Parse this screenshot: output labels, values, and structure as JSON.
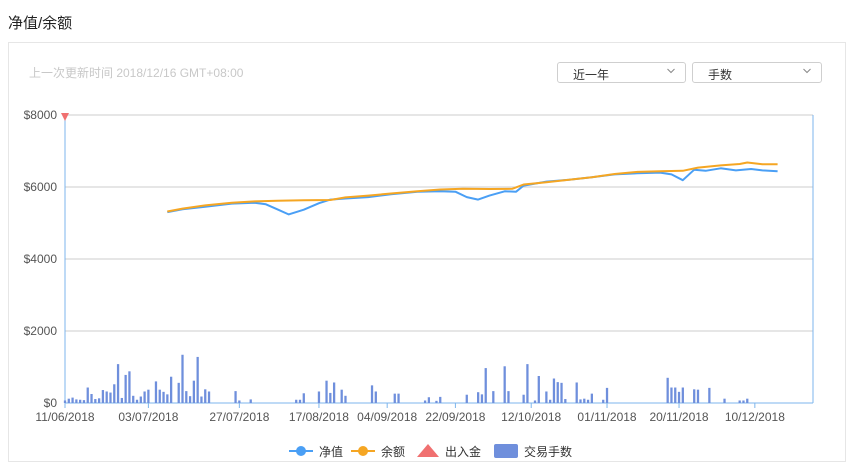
{
  "header": {
    "title": "净值/余额"
  },
  "last_update": "上一次更新时间 2018/12/16 GMT+08:00",
  "controls": {
    "period": {
      "selected": "近一年",
      "icon": "chevron-down-icon"
    },
    "metric": {
      "selected": "手数",
      "icon": "chevron-down-icon"
    }
  },
  "colors": {
    "net_value": "#4a9ff5",
    "balance": "#f5a623",
    "deposit_marker": "#f07070",
    "volume": "#6f8fdc",
    "grid": "#cccccc",
    "axis": "#7cb5ec"
  },
  "chart_data": {
    "type": "line",
    "x_tick_labels": [
      "11/06/2018",
      "03/07/2018",
      "27/07/2018",
      "17/08/2018",
      "04/09/2018",
      "22/09/2018",
      "12/10/2018",
      "01/11/2018",
      "20/11/2018",
      "10/12/2018"
    ],
    "x_ticks": [
      "2018-06-11",
      "2018-07-03",
      "2018-07-27",
      "2018-08-17",
      "2018-09-04",
      "2018-09-22",
      "2018-10-12",
      "2018-11-01",
      "2018-11-20",
      "2018-12-10"
    ],
    "y_tick_labels": [
      "$0",
      "$2000",
      "$4000",
      "$6000",
      "$8000"
    ],
    "y_ticks": [
      0,
      2000,
      4000,
      6000,
      8000
    ],
    "ylim": [
      0,
      8000
    ],
    "grid": true,
    "legend": {
      "placement": "bottom-center",
      "items": [
        {
          "label": "净值",
          "kind": "line",
          "series": "net_value"
        },
        {
          "label": "余额",
          "kind": "line",
          "series": "balance"
        },
        {
          "label": "出入金",
          "kind": "triangle",
          "series": "deposits"
        },
        {
          "label": "交易手数",
          "kind": "bar",
          "series": "volume"
        }
      ]
    },
    "series": [
      {
        "key": "balance",
        "name": "余额",
        "type": "line",
        "points": [
          [
            "2018-07-08",
            5320
          ],
          [
            "2018-07-12",
            5400
          ],
          [
            "2018-07-18",
            5490
          ],
          [
            "2018-07-25",
            5560
          ],
          [
            "2018-07-31",
            5600
          ],
          [
            "2018-08-06",
            5620
          ],
          [
            "2018-08-13",
            5630
          ],
          [
            "2018-08-20",
            5640
          ],
          [
            "2018-08-24",
            5710
          ],
          [
            "2018-08-30",
            5760
          ],
          [
            "2018-09-05",
            5820
          ],
          [
            "2018-09-12",
            5880
          ],
          [
            "2018-09-18",
            5930
          ],
          [
            "2018-09-24",
            5950
          ],
          [
            "2018-10-01",
            5945
          ],
          [
            "2018-10-07",
            5950
          ],
          [
            "2018-10-10",
            6070
          ],
          [
            "2018-10-16",
            6130
          ],
          [
            "2018-10-22",
            6200
          ],
          [
            "2018-10-28",
            6270
          ],
          [
            "2018-11-03",
            6360
          ],
          [
            "2018-11-09",
            6420
          ],
          [
            "2018-11-15",
            6440
          ],
          [
            "2018-11-21",
            6450
          ],
          [
            "2018-11-25",
            6540
          ],
          [
            "2018-12-01",
            6600
          ],
          [
            "2018-12-06",
            6640
          ],
          [
            "2018-12-08",
            6680
          ],
          [
            "2018-12-12",
            6630
          ],
          [
            "2018-12-16",
            6630
          ]
        ]
      },
      {
        "key": "net_value",
        "name": "净值",
        "type": "line",
        "points": [
          [
            "2018-07-08",
            5300
          ],
          [
            "2018-07-12",
            5380
          ],
          [
            "2018-07-18",
            5450
          ],
          [
            "2018-07-25",
            5540
          ],
          [
            "2018-07-31",
            5560
          ],
          [
            "2018-08-03",
            5520
          ],
          [
            "2018-08-06",
            5380
          ],
          [
            "2018-08-09",
            5240
          ],
          [
            "2018-08-13",
            5370
          ],
          [
            "2018-08-17",
            5550
          ],
          [
            "2018-08-20",
            5650
          ],
          [
            "2018-08-24",
            5680
          ],
          [
            "2018-08-30",
            5720
          ],
          [
            "2018-09-05",
            5800
          ],
          [
            "2018-09-12",
            5870
          ],
          [
            "2018-09-18",
            5880
          ],
          [
            "2018-09-22",
            5870
          ],
          [
            "2018-09-25",
            5720
          ],
          [
            "2018-09-28",
            5650
          ],
          [
            "2018-10-01",
            5760
          ],
          [
            "2018-10-05",
            5880
          ],
          [
            "2018-10-08",
            5870
          ],
          [
            "2018-10-10",
            6040
          ],
          [
            "2018-10-16",
            6150
          ],
          [
            "2018-10-22",
            6200
          ],
          [
            "2018-10-28",
            6270
          ],
          [
            "2018-11-03",
            6350
          ],
          [
            "2018-11-09",
            6380
          ],
          [
            "2018-11-15",
            6400
          ],
          [
            "2018-11-18",
            6350
          ],
          [
            "2018-11-21",
            6190
          ],
          [
            "2018-11-24",
            6480
          ],
          [
            "2018-11-27",
            6450
          ],
          [
            "2018-12-01",
            6520
          ],
          [
            "2018-12-05",
            6460
          ],
          [
            "2018-12-09",
            6500
          ],
          [
            "2018-12-12",
            6460
          ],
          [
            "2018-12-16",
            6440
          ]
        ]
      },
      {
        "key": "deposits",
        "name": "出入金",
        "type": "marker",
        "points": [
          [
            "2018-06-11",
            8000
          ]
        ]
      },
      {
        "key": "volume",
        "name": "交易手数",
        "type": "bar",
        "points": [
          [
            "2018-06-11",
            70
          ],
          [
            "2018-06-12",
            120
          ],
          [
            "2018-06-13",
            150
          ],
          [
            "2018-06-14",
            100
          ],
          [
            "2018-06-15",
            90
          ],
          [
            "2018-06-16",
            80
          ],
          [
            "2018-06-17",
            430
          ],
          [
            "2018-06-18",
            250
          ],
          [
            "2018-06-19",
            110
          ],
          [
            "2018-06-20",
            130
          ],
          [
            "2018-06-21",
            360
          ],
          [
            "2018-06-22",
            320
          ],
          [
            "2018-06-23",
            290
          ],
          [
            "2018-06-24",
            520
          ],
          [
            "2018-06-25",
            1080
          ],
          [
            "2018-06-26",
            140
          ],
          [
            "2018-06-27",
            780
          ],
          [
            "2018-06-28",
            880
          ],
          [
            "2018-06-29",
            200
          ],
          [
            "2018-06-30",
            90
          ],
          [
            "2018-07-01",
            180
          ],
          [
            "2018-07-02",
            320
          ],
          [
            "2018-07-03",
            370
          ],
          [
            "2018-07-05",
            600
          ],
          [
            "2018-07-06",
            370
          ],
          [
            "2018-07-07",
            310
          ],
          [
            "2018-07-08",
            240
          ],
          [
            "2018-07-09",
            730
          ],
          [
            "2018-07-11",
            560
          ],
          [
            "2018-07-12",
            1340
          ],
          [
            "2018-07-13",
            330
          ],
          [
            "2018-07-14",
            190
          ],
          [
            "2018-07-15",
            620
          ],
          [
            "2018-07-16",
            1280
          ],
          [
            "2018-07-17",
            180
          ],
          [
            "2018-07-18",
            380
          ],
          [
            "2018-07-19",
            320
          ],
          [
            "2018-07-26",
            330
          ],
          [
            "2018-07-27",
            70
          ],
          [
            "2018-07-30",
            100
          ],
          [
            "2018-08-11",
            90
          ],
          [
            "2018-08-12",
            90
          ],
          [
            "2018-08-13",
            270
          ],
          [
            "2018-08-17",
            320
          ],
          [
            "2018-08-19",
            620
          ],
          [
            "2018-08-20",
            280
          ],
          [
            "2018-08-21",
            570
          ],
          [
            "2018-08-23",
            370
          ],
          [
            "2018-08-24",
            200
          ],
          [
            "2018-08-31",
            490
          ],
          [
            "2018-09-01",
            320
          ],
          [
            "2018-09-06",
            260
          ],
          [
            "2018-09-07",
            260
          ],
          [
            "2018-09-14",
            70
          ],
          [
            "2018-09-15",
            160
          ],
          [
            "2018-09-17",
            60
          ],
          [
            "2018-09-18",
            170
          ],
          [
            "2018-09-25",
            230
          ],
          [
            "2018-09-28",
            300
          ],
          [
            "2018-09-29",
            240
          ],
          [
            "2018-09-30",
            970
          ],
          [
            "2018-10-02",
            330
          ],
          [
            "2018-10-05",
            1020
          ],
          [
            "2018-10-06",
            330
          ],
          [
            "2018-10-10",
            230
          ],
          [
            "2018-10-11",
            1080
          ],
          [
            "2018-10-13",
            70
          ],
          [
            "2018-10-14",
            750
          ],
          [
            "2018-10-16",
            320
          ],
          [
            "2018-10-17",
            90
          ],
          [
            "2018-10-18",
            680
          ],
          [
            "2018-10-19",
            580
          ],
          [
            "2018-10-20",
            560
          ],
          [
            "2018-10-21",
            110
          ],
          [
            "2018-10-24",
            570
          ],
          [
            "2018-10-25",
            100
          ],
          [
            "2018-10-26",
            120
          ],
          [
            "2018-10-27",
            90
          ],
          [
            "2018-10-28",
            260
          ],
          [
            "2018-10-31",
            90
          ],
          [
            "2018-11-01",
            420
          ],
          [
            "2018-11-17",
            700
          ],
          [
            "2018-11-18",
            430
          ],
          [
            "2018-11-19",
            430
          ],
          [
            "2018-11-20",
            310
          ],
          [
            "2018-11-21",
            430
          ],
          [
            "2018-11-24",
            380
          ],
          [
            "2018-11-25",
            370
          ],
          [
            "2018-11-28",
            420
          ],
          [
            "2018-12-02",
            120
          ],
          [
            "2018-12-06",
            70
          ],
          [
            "2018-12-07",
            70
          ],
          [
            "2018-12-08",
            120
          ]
        ]
      }
    ]
  }
}
